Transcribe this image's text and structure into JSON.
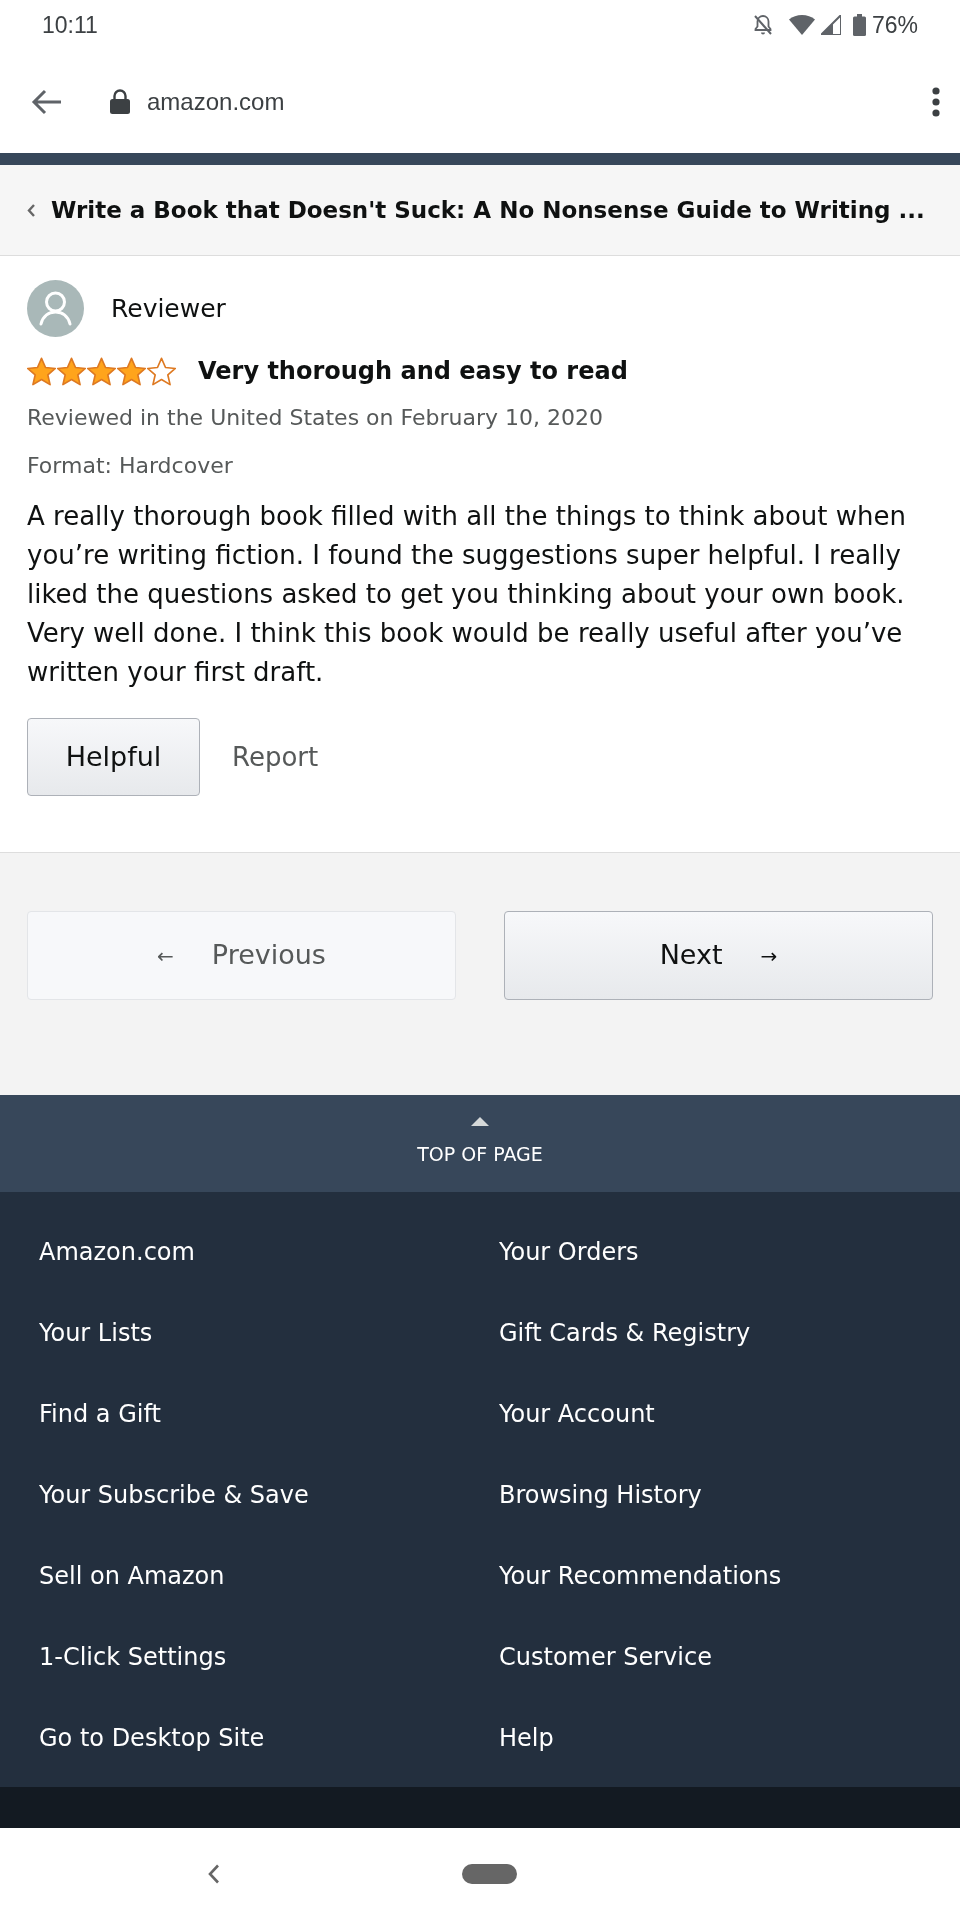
{
  "status_bar": {
    "time": "10:11",
    "battery": "76%"
  },
  "browser": {
    "url": "amazon.com"
  },
  "product": {
    "title": "Write a Book that Doesn't Suck: A No Nonsense Guide to Writing ..."
  },
  "review": {
    "reviewer": "Reviewer",
    "stars": 4,
    "title": "Very thorough and easy to read",
    "date": "Reviewed in the United States on February 10, 2020",
    "format": "Format: Hardcover",
    "body": "A really thorough book filled with all the things to think about when you’re writing fiction. I found the suggestions super helpful. I really liked the questions asked to get you thinking about your own book. Very well done. I think this book would be really useful after you’ve written your first draft.",
    "actions": [
      {
        "kind": "button",
        "label": "Helpful"
      },
      {
        "kind": "link",
        "label": "Report"
      }
    ]
  },
  "pagination": [
    {
      "kind": "previous",
      "label": "Previous",
      "arrow": "←",
      "disabled": true
    },
    {
      "kind": "next",
      "label": "Next",
      "arrow": "→",
      "disabled": false
    }
  ],
  "back_to_top": {
    "label": "TOP OF PAGE"
  },
  "footer_links": [
    "Amazon.com",
    "Your Orders",
    "Your Lists",
    "Gift Cards & Registry",
    "Find a Gift",
    "Your Account",
    "Your Subscribe & Save",
    "Browsing History",
    "Sell on Amazon",
    "Your Recommendations",
    "1-Click Settings",
    "Customer Service",
    "Go to Desktop Site",
    "Help"
  ]
}
